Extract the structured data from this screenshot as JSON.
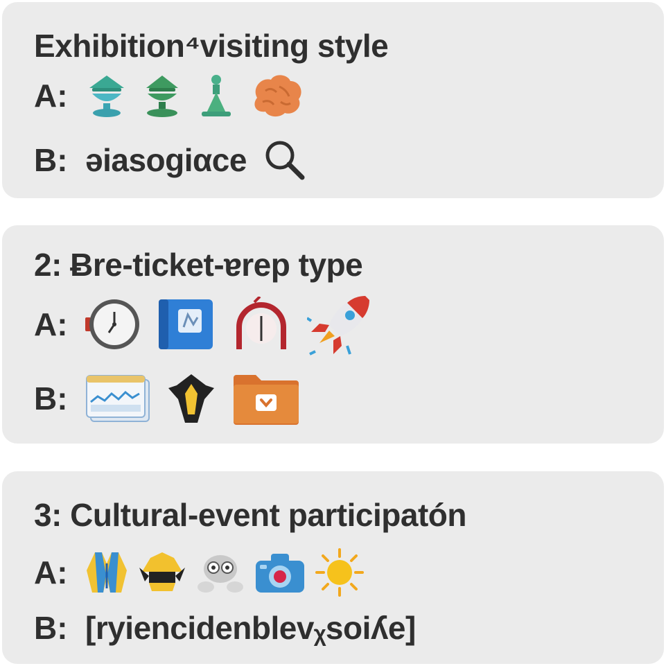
{
  "questions": [
    {
      "title": "Exhibition⁴visiting style",
      "option_a": {
        "label": "A:",
        "icons": [
          "teal-pedestal-bowl-icon",
          "green-pedestal-bowl-icon",
          "green-figurine-icon",
          "orange-brain-icon"
        ]
      },
      "option_b": {
        "label": "B:",
        "text": "əiasogiαce",
        "icons": [
          "magnifier-icon"
        ]
      }
    },
    {
      "title": "2: Ƀre-ticket-ɐrep type",
      "option_a": {
        "label": "A:",
        "icons": [
          "clock-icon",
          "blue-book-icon",
          "red-horseshoe-clock-icon",
          "rocket-icon"
        ]
      },
      "option_b": {
        "label": "B:",
        "icons": [
          "browser-window-icon",
          "yellow-gem-icon",
          "orange-folder-icon"
        ]
      }
    },
    {
      "title": "3: Cultural-event participatón",
      "option_a": {
        "label": "A:",
        "icons": [
          "yellow-jacket-icon",
          "crown-icon",
          "robot-face-icon",
          "camera-icon",
          "sun-icon"
        ]
      },
      "option_b": {
        "label": "B:",
        "text": "[ryiencidenblevᵪsoiʎe]"
      }
    }
  ],
  "colors": {
    "card_background": "#ebebeb",
    "text": "#2f2f2f"
  }
}
